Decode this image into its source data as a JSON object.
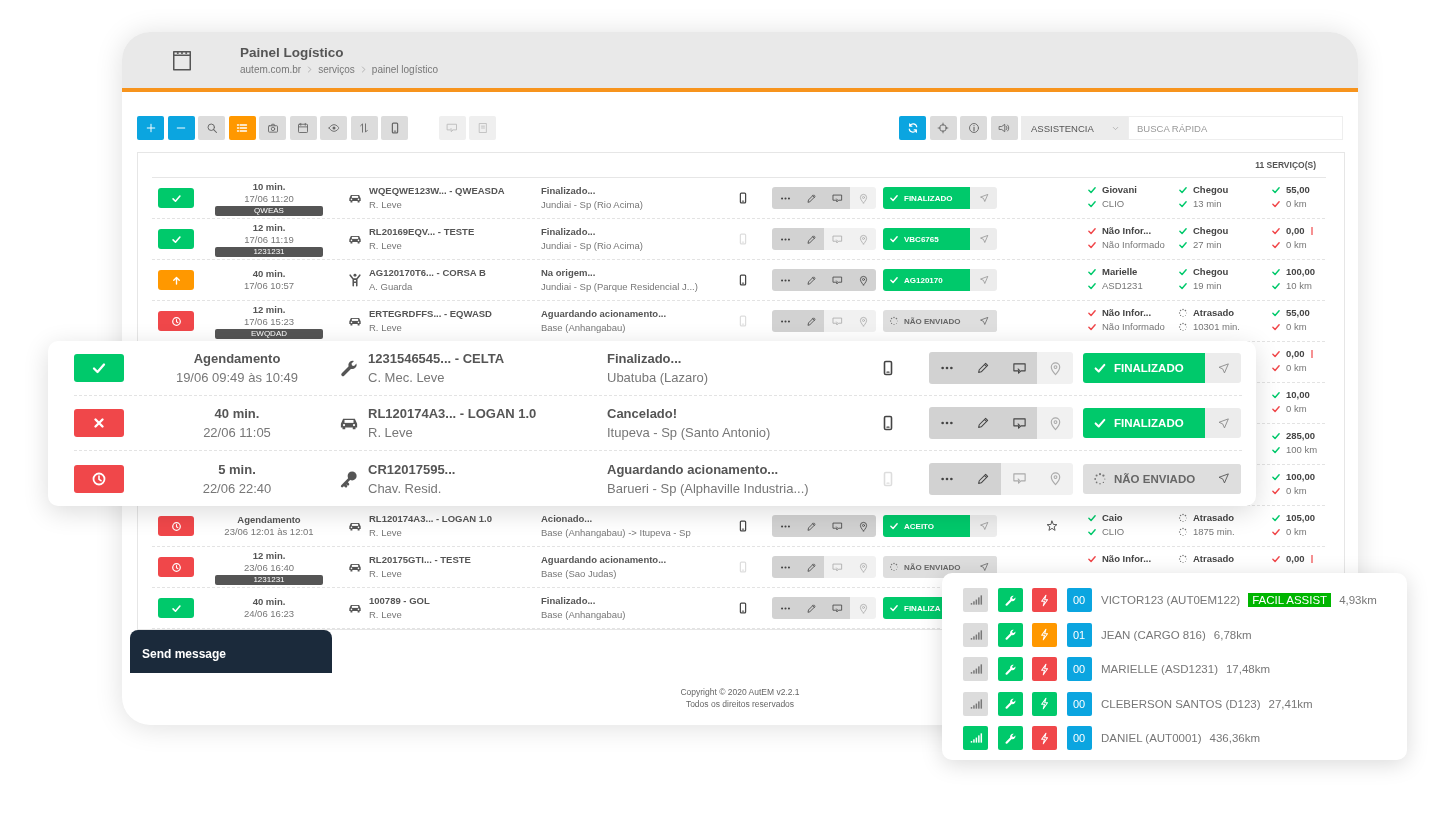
{
  "header": {
    "title": "Painel Logístico",
    "breadcrumb": [
      "autem.com.br",
      "serviços",
      "painel logístico"
    ]
  },
  "toolbar": {
    "left": [
      {
        "kind": "primary",
        "selected": false
      },
      {
        "kind": "primary",
        "selected": false
      },
      {
        "kind": "default",
        "selected": false
      },
      {
        "kind": "default",
        "selected": true
      },
      {
        "kind": "default",
        "selected": false
      },
      {
        "kind": "default",
        "selected": false
      },
      {
        "kind": "default",
        "selected": false
      },
      {
        "kind": "default",
        "selected": false
      },
      {
        "kind": "default",
        "selected": false
      },
      {
        "kind": "disabled",
        "selected": false
      },
      {
        "kind": "disabled",
        "selected": false
      }
    ],
    "right": [
      {
        "kind": "primary"
      },
      {
        "kind": "default"
      },
      {
        "kind": "default"
      },
      {
        "kind": "default"
      }
    ],
    "filter": {
      "value": "ASSISTENCIA"
    },
    "search": {
      "placeholder": "BUSCA RÁPIDA"
    }
  },
  "services": {
    "count": "11 SERVIÇO(S)",
    "rows": [
      {
        "kind": "done",
        "duration": "10 min.",
        "datetime": "17/06 11:20",
        "tag": "QWEAS",
        "vehicle": {
          "kind": "car"
        },
        "title": "WQEQWE123W... - QWEASDA",
        "service_type": "R. Leve",
        "stage": "Finalizado...",
        "address": "Jundiai - Sp (Rio Acima)",
        "phone_active": true,
        "chat_active": true,
        "pin_active": false,
        "state": {
          "kind": "done",
          "label": "FINALIZADO"
        },
        "starred": false,
        "driver": [
          {
            "kind": "ok",
            "text": "Giovani"
          },
          {
            "kind": "ok",
            "text": "CLIO"
          }
        ],
        "arrival": [
          {
            "kind": "ok",
            "text": "Chegou"
          },
          {
            "kind": "ok",
            "text": "13 min"
          }
        ],
        "value": [
          {
            "kind": "ok",
            "text": "55,00",
            "alert": false
          },
          {
            "kind": "fail",
            "text": "0 km",
            "alert": false
          }
        ]
      },
      {
        "kind": "done",
        "duration": "12 min.",
        "datetime": "17/06 11:19",
        "tag": "1231231",
        "vehicle": {
          "kind": "car"
        },
        "title": "RL20169EQV... - TESTE",
        "service_type": "R. Leve",
        "stage": "Finalizado...",
        "address": "Jundiai - Sp (Rio Acima)",
        "phone_active": false,
        "chat_active": false,
        "pin_active": false,
        "state": {
          "kind": "done",
          "label": "VBC6765"
        },
        "starred": false,
        "driver": [
          {
            "kind": "fail",
            "text": "Não Infor..."
          },
          {
            "kind": "fail",
            "text": "Não Informado"
          }
        ],
        "arrival": [
          {
            "kind": "ok",
            "text": "Chegou"
          },
          {
            "kind": "ok",
            "text": "27 min"
          }
        ],
        "value": [
          {
            "kind": "fail",
            "text": "0,00",
            "alert": true
          },
          {
            "kind": "fail",
            "text": "0 km",
            "alert": false
          }
        ]
      },
      {
        "kind": "origin",
        "duration": "40 min.",
        "datetime": "17/06 10:57",
        "vehicle": {
          "kind": "person"
        },
        "title": "AG120170T6... - CORSA B",
        "service_type": "A. Guarda",
        "stage": "Na origem...",
        "address": "Jundiai - Sp (Parque Residencial J...)",
        "phone_active": true,
        "chat_active": true,
        "pin_active": true,
        "state": {
          "kind": "done",
          "label": "AG120170"
        },
        "starred": false,
        "driver": [
          {
            "kind": "ok",
            "text": "Marielle"
          },
          {
            "kind": "ok",
            "text": "ASD1231"
          }
        ],
        "arrival": [
          {
            "kind": "ok",
            "text": "Chegou"
          },
          {
            "kind": "ok",
            "text": "19 min"
          }
        ],
        "value": [
          {
            "kind": "ok",
            "text": "100,00",
            "alert": false
          },
          {
            "kind": "ok",
            "text": "10 km",
            "alert": false
          }
        ]
      },
      {
        "kind": "waiting",
        "duration": "12 min.",
        "datetime": "17/06 15:23",
        "tag": "EWQDAD",
        "vehicle": {
          "kind": "car"
        },
        "title": "ERTEGRDFFS... - EQWASD",
        "service_type": "R. Leve",
        "stage": "Aguardando acionamento...",
        "address": "Base (Anhangabau)",
        "phone_active": false,
        "chat_active": false,
        "pin_active": false,
        "state": {
          "kind": "pending",
          "label": "NÃO ENVIADO"
        },
        "starred": false,
        "driver": [
          {
            "kind": "fail",
            "text": "Não Infor..."
          },
          {
            "kind": "fail",
            "text": "Não Informado"
          }
        ],
        "arrival": [
          {
            "kind": "pending",
            "text": "Atrasado"
          },
          {
            "kind": "pending",
            "text": "10301 min."
          }
        ],
        "value": [
          {
            "kind": "ok",
            "text": "55,00",
            "alert": false
          },
          {
            "kind": "fail",
            "text": "0 km",
            "alert": false
          }
        ]
      },
      {
        "value": [
          {
            "kind": "fail",
            "text": "0,00",
            "alert": true
          },
          {
            "kind": "fail",
            "text": "0 km",
            "alert": false
          }
        ]
      },
      {
        "value": [
          {
            "kind": "ok",
            "text": "10,00",
            "alert": false
          },
          {
            "kind": "fail",
            "text": "0 km",
            "alert": false
          }
        ]
      },
      {
        "value": [
          {
            "kind": "ok",
            "text": "285,00",
            "alert": false
          },
          {
            "kind": "ok",
            "text": "100 km",
            "alert": false
          }
        ]
      },
      {
        "value": [
          {
            "kind": "ok",
            "text": "100,00",
            "alert": false
          },
          {
            "kind": "fail",
            "text": "0 km",
            "alert": false
          }
        ]
      },
      {
        "kind": "waiting",
        "duration": "Agendamento",
        "datetime": "23/06 12:01 às 12:01",
        "vehicle": {
          "kind": "car"
        },
        "title": "RL120174A3... - LOGAN 1.0",
        "service_type": "R. Leve",
        "stage": "Acionado...",
        "address": "Base (Anhangabau) -> Itupeva - Sp",
        "phone_active": true,
        "chat_active": true,
        "pin_active": true,
        "state": {
          "kind": "done",
          "label": "ACEITO"
        },
        "starred": true,
        "driver": [
          {
            "kind": "ok",
            "text": "Caio"
          },
          {
            "kind": "ok",
            "text": "CLIO"
          }
        ],
        "arrival": [
          {
            "kind": "pending",
            "text": "Atrasado"
          },
          {
            "kind": "pending",
            "text": "1875 min."
          }
        ],
        "value": [
          {
            "kind": "ok",
            "text": "105,00",
            "alert": false
          },
          {
            "kind": "fail",
            "text": "0 km",
            "alert": false
          }
        ]
      },
      {
        "kind": "waiting",
        "duration": "12 min.",
        "datetime": "23/06 16:40",
        "tag": "1231231",
        "vehicle": {
          "kind": "car"
        },
        "title": "RL20175GTI... - TESTE",
        "service_type": "R. Leve",
        "stage": "Aguardando acionamento...",
        "address": "Base (Sao Judas)",
        "phone_active": false,
        "chat_active": false,
        "pin_active": false,
        "state": {
          "kind": "pending",
          "label": "NÃO ENVIADO"
        },
        "starred": false,
        "driver": [
          {
            "kind": "fail",
            "text": "Não Infor..."
          }
        ],
        "arrival": [
          {
            "kind": "pending",
            "text": "Atrasado"
          }
        ],
        "value": [
          {
            "kind": "fail",
            "text": "0,00",
            "alert": true
          }
        ]
      },
      {
        "kind": "done",
        "duration": "40 min.",
        "datetime": "24/06 16:23",
        "vehicle": {
          "kind": "car"
        },
        "title": "100789 - GOL",
        "service_type": "R. Leve",
        "stage": "Finalizado...",
        "address": "Base (Anhangabau)",
        "phone_active": true,
        "chat_active": true,
        "pin_active": false,
        "state": {
          "kind": "done",
          "label": "FINALIZA",
          "send_button": false
        },
        "starred": false
      }
    ]
  },
  "focus_rows": [
    {
      "kind": "done",
      "duration": "Agendamento",
      "datetime": "19/06 09:49 às 10:49",
      "vehicle": {
        "kind": "wrench"
      },
      "title": "1231546545... - CELTA",
      "service_type": "C. Mec. Leve",
      "stage": "Finalizado...",
      "address": "Ubatuba (Lazaro)",
      "phone_active": true,
      "chat_active": true,
      "pin_active": false,
      "state": {
        "kind": "done",
        "label": "FINALIZADO"
      }
    },
    {
      "kind": "cancelled",
      "duration": "40 min.",
      "datetime": "22/06 11:05",
      "vehicle": {
        "kind": "car"
      },
      "title": "RL120174A3... - LOGAN 1.0",
      "service_type": "R. Leve",
      "stage": "Cancelado!",
      "address": "Itupeva - Sp (Santo Antonio)",
      "phone_active": true,
      "chat_active": true,
      "pin_active": false,
      "state": {
        "kind": "done",
        "label": "FINALIZADO"
      }
    },
    {
      "kind": "waiting",
      "duration": "5 min.",
      "datetime": "22/06 22:40",
      "vehicle": {
        "kind": "key"
      },
      "title": "CR12017595...",
      "service_type": "Chav. Resid.",
      "stage": "Aguardando acionamento...",
      "address": "Barueri - Sp (Alphaville Industria...)",
      "phone_active": false,
      "chat_active": false,
      "pin_active": false,
      "state": {
        "kind": "pending",
        "label": "NÃO ENVIADO"
      }
    }
  ],
  "footer": {
    "copyright": "Copyright © 2020 AutEM v2.2.1",
    "rights": "Todos os direitos reservados"
  },
  "chat": {
    "label": "Send message"
  },
  "drivers": [
    {
      "online": false,
      "color": "#f0474a",
      "count": "00",
      "name": "VICTOR123 (AUT0EM122)",
      "tag": "FACIL ASSIST",
      "distance": "4,93km"
    },
    {
      "online": false,
      "color": "#ff9800",
      "count": "01",
      "name": "JEAN (CARGO 816)",
      "distance": "6,78km"
    },
    {
      "online": false,
      "color": "#f0474a",
      "count": "00",
      "name": "MARIELLE (ASD1231)",
      "distance": "17,48km"
    },
    {
      "online": false,
      "color": "#00c96b",
      "count": "00",
      "name": "CLEBERSON SANTOS (D123)",
      "distance": "27,41km"
    },
    {
      "online": true,
      "color": "#f0474a",
      "count": "00",
      "name": "DANIEL (AUT0001)",
      "distance": "436,36km"
    }
  ]
}
